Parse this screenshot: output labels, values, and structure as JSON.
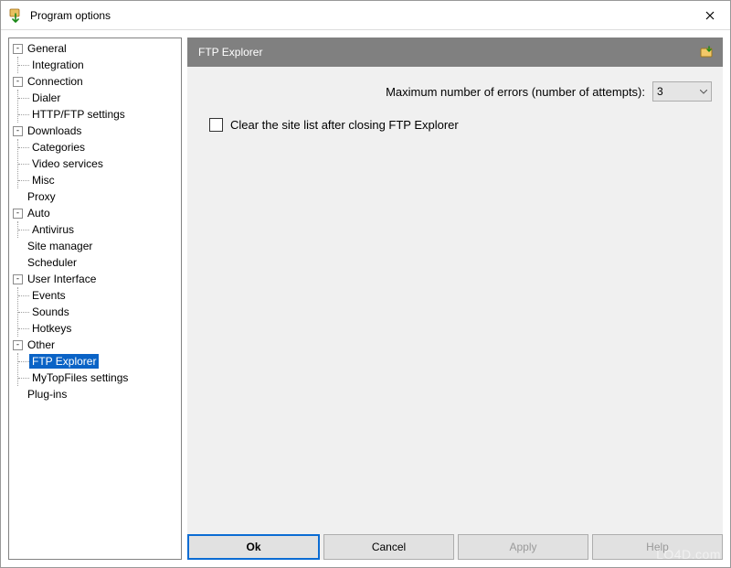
{
  "window": {
    "title": "Program options"
  },
  "tree": {
    "general": {
      "label": "General",
      "integration": "Integration"
    },
    "connection": {
      "label": "Connection",
      "dialer": "Dialer",
      "http_ftp": "HTTP/FTP settings"
    },
    "downloads": {
      "label": "Downloads",
      "categories": "Categories",
      "video_services": "Video services",
      "misc": "Misc"
    },
    "proxy": {
      "label": "Proxy"
    },
    "auto": {
      "label": "Auto",
      "antivirus": "Antivirus"
    },
    "site_manager": {
      "label": "Site manager"
    },
    "scheduler": {
      "label": "Scheduler"
    },
    "ui": {
      "label": "User Interface",
      "events": "Events",
      "sounds": "Sounds",
      "hotkeys": "Hotkeys"
    },
    "other": {
      "label": "Other",
      "ftp_explorer": "FTP Explorer",
      "mytopfiles": "MyTopFiles settings"
    },
    "plugins": {
      "label": "Plug-ins"
    }
  },
  "content": {
    "header": "FTP Explorer",
    "max_errors_label": "Maximum number of errors (number of attempts):",
    "max_errors_value": "3",
    "clear_list_label": "Clear the site list after closing FTP Explorer",
    "clear_list_checked": false
  },
  "buttons": {
    "ok": "Ok",
    "cancel": "Cancel",
    "apply": "Apply",
    "help": "Help"
  },
  "watermark": "LO4D.com"
}
